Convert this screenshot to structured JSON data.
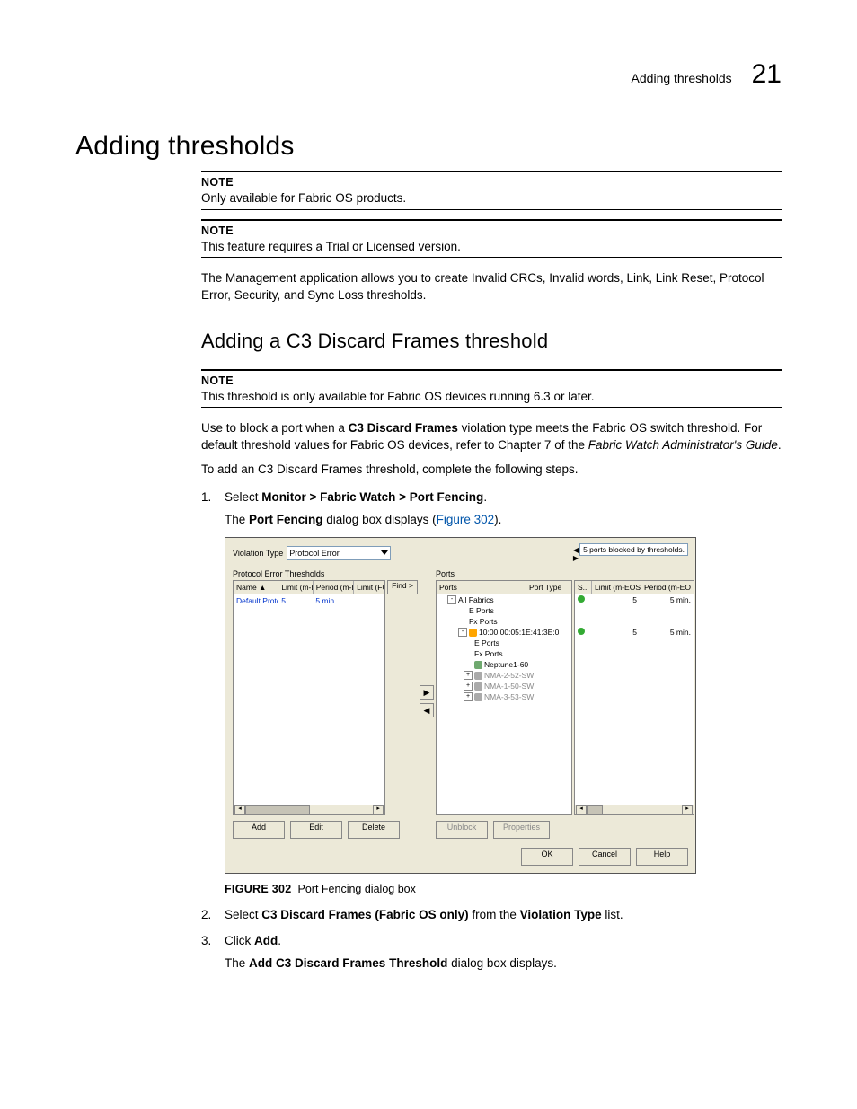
{
  "header": {
    "running": "Adding thresholds",
    "chapter": "21"
  },
  "h1": "Adding thresholds",
  "note1": {
    "label": "NOTE",
    "body": "Only available for Fabric OS products."
  },
  "note2": {
    "label": "NOTE",
    "body": "This feature requires a Trial or Licensed version."
  },
  "intro": "The Management application allows you to create Invalid CRCs, Invalid words, Link, Link Reset, Protocol Error, Security, and Sync Loss thresholds.",
  "h2": "Adding a C3 Discard Frames threshold",
  "note3": {
    "label": "NOTE",
    "body": "This threshold is only available for Fabric OS devices running 6.3 or later."
  },
  "para1_a": "Use to block a port when a ",
  "para1_b": "C3 Discard Frames",
  "para1_c": " violation type meets the Fabric OS switch threshold. For default threshold values for Fabric OS devices, refer to Chapter 7 of the ",
  "para1_d": "Fabric Watch Administrator's Guide",
  "para1_e": ".",
  "para2": "To add an C3 Discard Frames threshold, complete the following steps.",
  "step1": {
    "num": "1.",
    "pre": "Select ",
    "bold": "Monitor > Fabric Watch > Port Fencing",
    "post": "."
  },
  "step1b_a": "The ",
  "step1b_b": "Port Fencing",
  "step1b_c": " dialog box displays (",
  "step1b_link": "Figure 302",
  "step1b_d": ").",
  "dialog": {
    "violation_label": "Violation Type",
    "violation_value": "Protocol Error",
    "blocked_msg": "5 ports blocked by thresholds.",
    "left_title": "Protocol Error Thresholds",
    "left_headers": [
      "Name ▲",
      "Limit (m-EOS)",
      "Period (m-EOS)",
      "Limit (FOS)"
    ],
    "left_row": {
      "name": "Default Protocol Er...",
      "limit_meos": "5",
      "period_meos": "5 min.",
      "limit_fos": ""
    },
    "find": "Find >",
    "buttons_left": [
      "Add",
      "Edit",
      "Delete"
    ],
    "ports_title": "Ports",
    "ports_headers": [
      "Ports",
      "Port Type"
    ],
    "tree": [
      {
        "lvl": 0,
        "pm": "-",
        "icon": "",
        "text": "All Fabrics"
      },
      {
        "lvl": 1,
        "pm": "",
        "icon": "",
        "text": "E Ports",
        "muted": false
      },
      {
        "lvl": 1,
        "pm": "",
        "icon": "",
        "text": "Fx Ports",
        "muted": false
      },
      {
        "lvl": 1,
        "pm": "-",
        "icon": "fab",
        "text": "10:00:00:05:1E:41:3E:0"
      },
      {
        "lvl": 2,
        "pm": "",
        "icon": "",
        "text": "E Ports"
      },
      {
        "lvl": 2,
        "pm": "",
        "icon": "",
        "text": "Fx Ports"
      },
      {
        "lvl": 2,
        "pm": "",
        "icon": "sw",
        "text": "Neptune1-60"
      },
      {
        "lvl": 2,
        "pm": "+",
        "icon": "g",
        "text": "NMA-2-52-SW",
        "muted": true
      },
      {
        "lvl": 2,
        "pm": "+",
        "icon": "g",
        "text": "NMA-1-50-SW",
        "muted": true
      },
      {
        "lvl": 2,
        "pm": "+",
        "icon": "g",
        "text": "NMA-3-53-SW",
        "muted": true
      }
    ],
    "r_headers": [
      "S..",
      "Limit (m-EOS)",
      "Period (m-EO"
    ],
    "r_rows": [
      {
        "s": "dot",
        "limit": "5",
        "period": "5 min."
      },
      {
        "s": "",
        "limit": "",
        "period": ""
      },
      {
        "s": "",
        "limit": "",
        "period": ""
      },
      {
        "s": "dot",
        "limit": "5",
        "period": "5 min."
      }
    ],
    "buttons_right": [
      "Unblock",
      "Properties"
    ],
    "buttons_bottom": [
      "OK",
      "Cancel",
      "Help"
    ]
  },
  "figcap": {
    "label": "FIGURE 302",
    "text": "Port Fencing dialog box"
  },
  "step2": {
    "num": "2.",
    "a": "Select ",
    "b": "C3 Discard Frames (Fabric OS only)",
    "c": " from the ",
    "d": "Violation Type",
    "e": " list."
  },
  "step3": {
    "num": "3.",
    "a": "Click ",
    "b": "Add",
    "c": "."
  },
  "step3b_a": "The ",
  "step3b_b": "Add C3 Discard Frames Threshold",
  "step3b_c": " dialog box displays."
}
